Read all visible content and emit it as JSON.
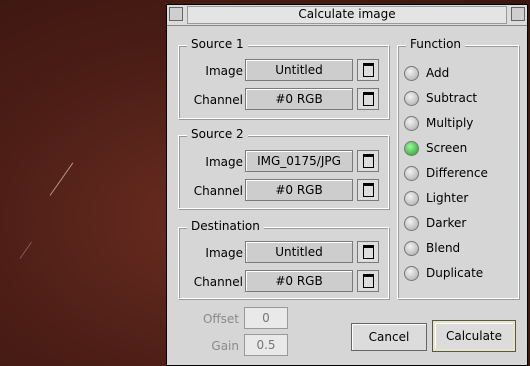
{
  "window": {
    "title": "Calculate image"
  },
  "source1": {
    "title": "Source 1",
    "image_label": "Image",
    "image_value": "Untitled",
    "channel_label": "Channel",
    "channel_value": "#0  RGB"
  },
  "source2": {
    "title": "Source 2",
    "image_label": "Image",
    "image_value": "IMG_0175/JPG",
    "channel_label": "Channel",
    "channel_value": "#0  RGB"
  },
  "destination": {
    "title": "Destination",
    "image_label": "Image",
    "image_value": "Untitled",
    "channel_label": "Channel",
    "channel_value": "#0  RGB"
  },
  "function": {
    "title": "Function",
    "options": [
      "Add",
      "Subtract",
      "Multiply",
      "Screen",
      "Difference",
      "Lighter",
      "Darker",
      "Blend",
      "Duplicate"
    ],
    "selected": "Screen"
  },
  "offset": {
    "label": "Offset",
    "value": "0"
  },
  "gain": {
    "label": "Gain",
    "value": "0.5"
  },
  "buttons": {
    "cancel": "Cancel",
    "calculate": "Calculate"
  }
}
